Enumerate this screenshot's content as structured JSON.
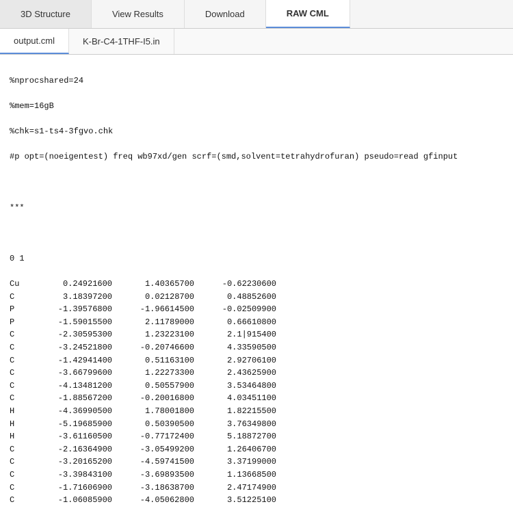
{
  "tabs": [
    {
      "id": "3d-structure",
      "label": "3D Structure",
      "active": false
    },
    {
      "id": "view-results",
      "label": "View Results",
      "active": false
    },
    {
      "id": "download",
      "label": "Download",
      "active": false
    },
    {
      "id": "raw-cml",
      "label": "RAW CML",
      "active": true
    }
  ],
  "file_tabs": [
    {
      "id": "output-cml",
      "label": "output.cml",
      "active": true
    },
    {
      "id": "k-br-c4",
      "label": "K-Br-C4-1THF-I5.in",
      "active": false
    }
  ],
  "content": {
    "header_lines": [
      "%nprocshared=24",
      "%mem=16gB",
      "%chk=s1-ts4-3fgvo.chk",
      "#p opt=(noeigentest) freq wb97xd/gen scrf=(smd,solvent=tetrahydrofuran) pseudo=read gfinput"
    ],
    "separator": "***",
    "charge_mult": "0 1",
    "atoms": [
      {
        "atom": "Cu",
        "x": "0.24921600",
        "y": "1.40365700",
        "z": "-0.62230600"
      },
      {
        "atom": "C",
        "x": "3.18397200",
        "y": "0.02128700",
        "z": "0.48852600"
      },
      {
        "atom": "P",
        "x": "-1.39576800",
        "y": "-1.96614500",
        "z": "-0.02509900"
      },
      {
        "atom": "P",
        "x": "-1.59015500",
        "y": "2.11789000",
        "z": "0.66610800"
      },
      {
        "atom": "C",
        "x": "-2.30595300",
        "y": "1.23223100",
        "z": "2.1|915400"
      },
      {
        "atom": "C",
        "x": "-3.24521800",
        "y": "-0.20746600",
        "z": "4.33590500"
      },
      {
        "atom": "C",
        "x": "-1.42941400",
        "y": "0.51163100",
        "z": "2.92706100"
      },
      {
        "atom": "C",
        "x": "-3.66799600",
        "y": "1.22273300",
        "z": "2.43625900"
      },
      {
        "atom": "C",
        "x": "-4.13481200",
        "y": "0.50557900",
        "z": "3.53464800"
      },
      {
        "atom": "C",
        "x": "-1.88567200",
        "y": "-0.20016800",
        "z": "4.03451100"
      },
      {
        "atom": "H",
        "x": "-4.36990500",
        "y": "1.78001800",
        "z": "1.82215500"
      },
      {
        "atom": "H",
        "x": "-5.19685900",
        "y": "0.50390500",
        "z": "3.76349800"
      },
      {
        "atom": "H",
        "x": "-3.61160500",
        "y": "-0.77172400",
        "z": "5.18872700"
      },
      {
        "atom": "C",
        "x": "-2.16364900",
        "y": "-3.05499200",
        "z": "1.26406700"
      },
      {
        "atom": "C",
        "x": "-3.20165200",
        "y": "-4.59741500",
        "z": "3.37199000"
      },
      {
        "atom": "C",
        "x": "-3.39843100",
        "y": "-3.69893500",
        "z": "1.13668500"
      },
      {
        "atom": "C",
        "x": "-1.71606900",
        "y": "-3.18638700",
        "z": "2.47174900"
      },
      {
        "atom": "C",
        "x": "-1.06085900",
        "y": "-4.05062800",
        "z": "3.51225100"
      }
    ]
  },
  "colors": {
    "active_tab_border": "#5b8dd9",
    "tab_bg": "#f5f5f5",
    "active_tab_bg": "#fff"
  }
}
